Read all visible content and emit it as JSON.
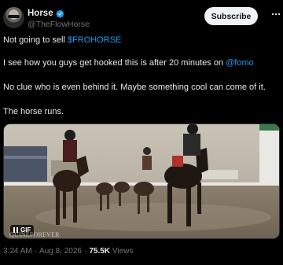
{
  "author": {
    "display_name": "Horse",
    "handle": "@TheFlowHorse",
    "verified_icon": "verified-badge-icon",
    "avatar_icon": "avatar-image"
  },
  "actions": {
    "subscribe_label": "Subscribe",
    "more_icon": "more-options-icon"
  },
  "post": {
    "line1_text": "Not going to sell ",
    "line1_link": "$FROHORSE",
    "line2_text": "I see how you guys get hooked this is after 20 minutes on ",
    "line2_link": "@fomo",
    "line3_text": "No clue who is even behind it. Maybe something cool can come of it.",
    "line4_text": "The horse runs."
  },
  "media": {
    "type": "gif",
    "badge_label": "GIF",
    "pause_icon": "pause-icon",
    "watermark": "QUINEFOREVER"
  },
  "meta": {
    "time": "3:24 AM",
    "separator1": "·",
    "date": "Aug 8, 2026",
    "separator2": "·",
    "views_count": "75.5K",
    "views_label": "Views"
  },
  "colors": {
    "background": "#000000",
    "text": "#e7e9ea",
    "secondary_text": "#71767b",
    "link": "#1d9bf0",
    "verified": "#1d9bf0"
  }
}
